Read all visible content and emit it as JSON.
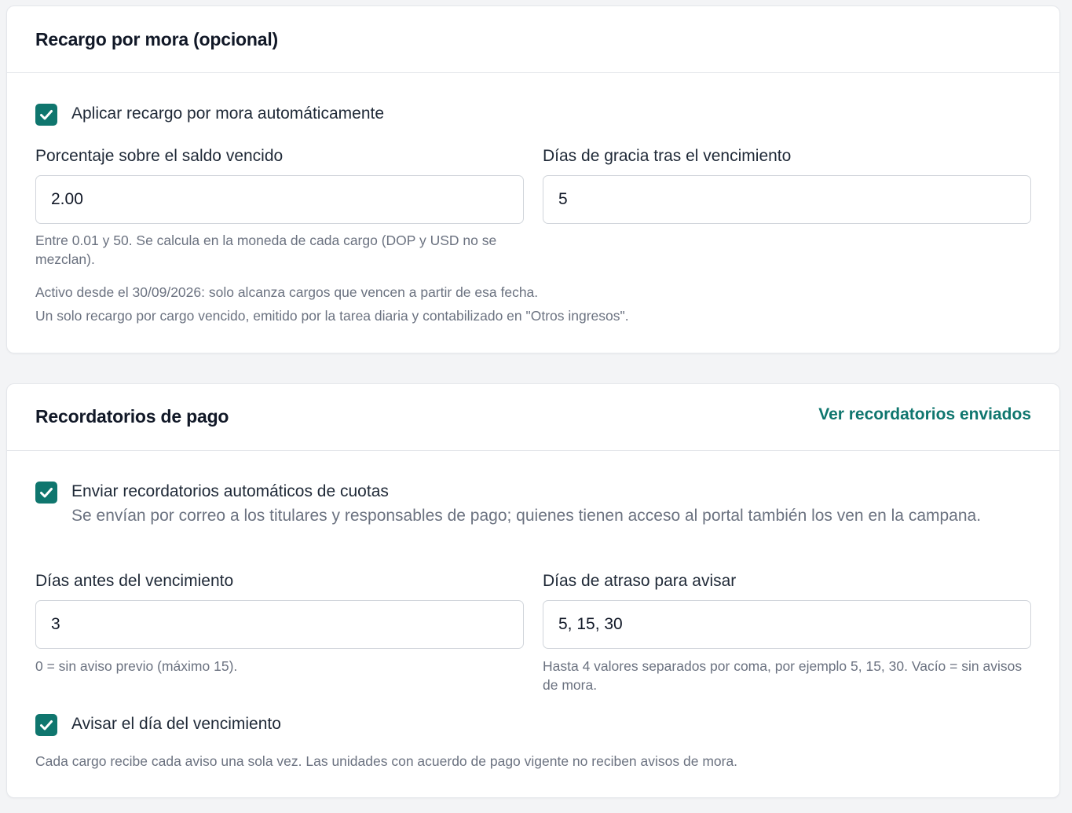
{
  "late_fee": {
    "title": "Recargo por mora (opcional)",
    "apply_checkbox": {
      "label": "Aplicar recargo por mora automáticamente",
      "checked": true
    },
    "percentage": {
      "label": "Porcentaje sobre el saldo vencido",
      "value": "2.00",
      "hint": "Entre 0.01 y 50. Se calcula en la moneda de cada cargo (DOP y USD no se mezclan)."
    },
    "grace_days": {
      "label": "Días de gracia tras el vencimiento",
      "value": "5"
    },
    "note_active": "Activo desde el 30/09/2026: solo alcanza cargos que vencen a partir de esa fecha.",
    "note_single": "Un solo recargo por cargo vencido, emitido por la tarea diaria y contabilizado en \"Otros ingresos\"."
  },
  "reminders": {
    "title": "Recordatorios de pago",
    "view_link": "Ver recordatorios enviados",
    "auto_checkbox": {
      "label": "Enviar recordatorios automáticos de cuotas",
      "description": "Se envían por correo a los titulares y responsables de pago; quienes tienen acceso al portal también los ven en la campana.",
      "checked": true
    },
    "days_before": {
      "label": "Días antes del vencimiento",
      "value": "3",
      "hint": "0 = sin aviso previo (máximo 15)."
    },
    "days_overdue": {
      "label": "Días de atraso para avisar",
      "value": "5, 15, 30",
      "hint": "Hasta 4 valores separados por coma, por ejemplo 5, 15, 30. Vacío = sin avisos de mora."
    },
    "due_day_checkbox": {
      "label": "Avisar el día del vencimiento",
      "checked": true
    },
    "footer_note": "Cada cargo recibe cada aviso una sola vez. Las unidades con acuerdo de pago vigente no reciben avisos de mora."
  },
  "colors": {
    "accent": "#0f766e",
    "muted_text": "#6b7280",
    "border": "#d1d5db"
  }
}
